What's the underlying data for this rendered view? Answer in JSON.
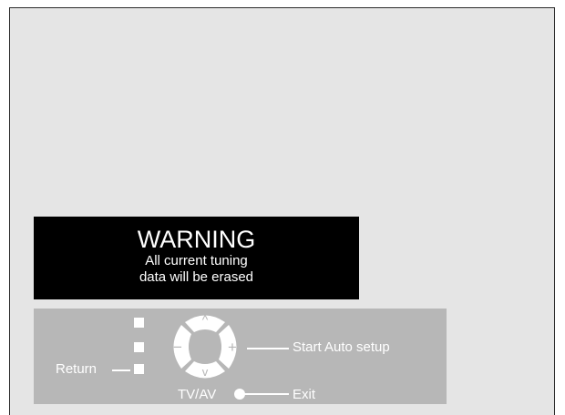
{
  "warning": {
    "title": "WARNING",
    "line1": "All current tuning",
    "line2": "data will be erased"
  },
  "controls": {
    "return_label": "Return",
    "start_label": "Start Auto setup",
    "tvav_label": "TV/AV",
    "exit_label": "Exit",
    "dpad": {
      "up": "^",
      "down": "v",
      "left": "−",
      "right": "+"
    }
  },
  "colors": {
    "screen_bg": "#e5e5e5",
    "warning_bg": "#000000",
    "panel_bg": "#b7b7b7",
    "text_on_dark": "#ffffff"
  }
}
